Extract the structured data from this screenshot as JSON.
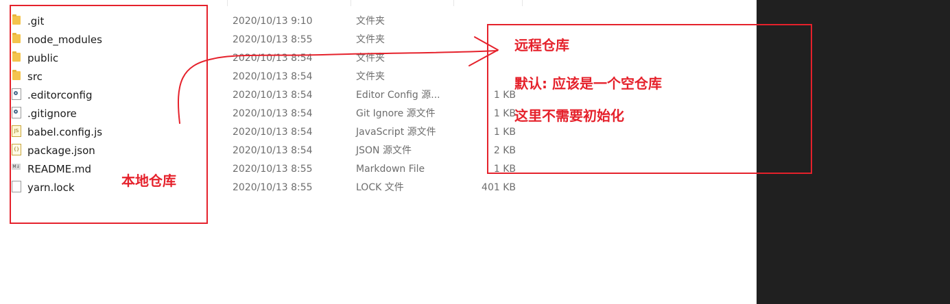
{
  "files": [
    {
      "name": ".git",
      "date": "2020/10/13 9:10",
      "type": "文件夹",
      "size": "",
      "icon": "folder-icon"
    },
    {
      "name": "node_modules",
      "date": "2020/10/13 8:55",
      "type": "文件夹",
      "size": "",
      "icon": "folder-icon"
    },
    {
      "name": "public",
      "date": "2020/10/13 8:54",
      "type": "文件夹",
      "size": "",
      "icon": "folder-icon"
    },
    {
      "name": "src",
      "date": "2020/10/13 8:54",
      "type": "文件夹",
      "size": "",
      "icon": "folder-icon"
    },
    {
      "name": ".editorconfig",
      "date": "2020/10/13 8:54",
      "type": "Editor Config 源...",
      "size": "1 KB",
      "icon": "config-file-icon"
    },
    {
      "name": ".gitignore",
      "date": "2020/10/13 8:54",
      "type": "Git Ignore 源文件",
      "size": "1 KB",
      "icon": "config-file-icon"
    },
    {
      "name": "babel.config.js",
      "date": "2020/10/13 8:54",
      "type": "JavaScript 源文件",
      "size": "1 KB",
      "icon": "js-file-icon"
    },
    {
      "name": "package.json",
      "date": "2020/10/13 8:54",
      "type": "JSON 源文件",
      "size": "2 KB",
      "icon": "json-file-icon"
    },
    {
      "name": "README.md",
      "date": "2020/10/13 8:55",
      "type": "Markdown File",
      "size": "1 KB",
      "icon": "markdown-file-icon"
    },
    {
      "name": "yarn.lock",
      "date": "2020/10/13 8:55",
      "type": "LOCK 文件",
      "size": "401 KB",
      "icon": "generic-file-icon"
    }
  ],
  "annotations": {
    "local_label": "本地仓库",
    "remote_title": "远程仓库",
    "remote_line1": "默认: 应该是一个空仓库",
    "remote_line2": "这里不需要初始化",
    "color": "#e5212b"
  }
}
